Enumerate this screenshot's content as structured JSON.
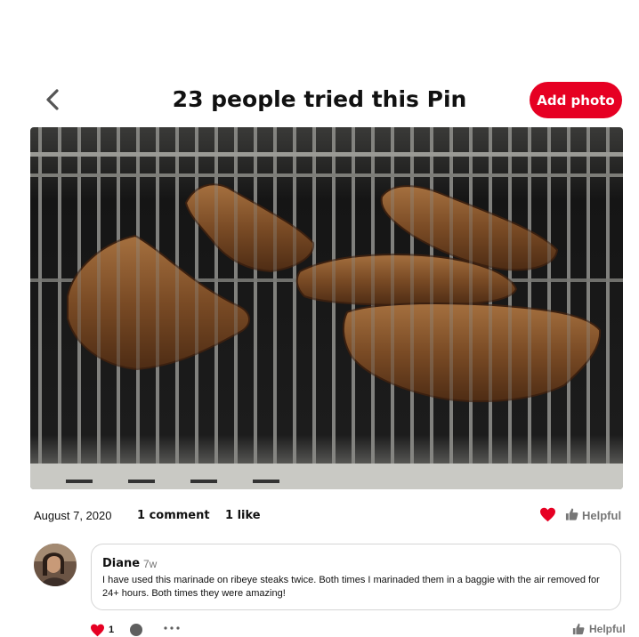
{
  "header": {
    "title": "23 people tried this Pin",
    "add_photo_label": "Add photo"
  },
  "meta": {
    "date": "August 7, 2020",
    "comments": "1 comment",
    "likes": "1 like",
    "helpful_label": "Helpful"
  },
  "comment": {
    "author": "Diane",
    "time_ago": "7w",
    "text": "I have used this marinade on ribeye steaks twice.  Both times I marinaded them in a baggie with the air removed for 24+ hours.  Both times they were amazing!",
    "like_count": "1",
    "helpful_label": "Helpful"
  },
  "icons": {
    "back": "chevron-left-icon",
    "heart": "heart-icon",
    "thumb": "thumbs-up-icon",
    "reply": "comment-bubble-icon",
    "more": "more-dots-icon"
  },
  "colors": {
    "brand_red": "#e60023",
    "muted_text": "#767676",
    "border": "#d5d5d5"
  }
}
